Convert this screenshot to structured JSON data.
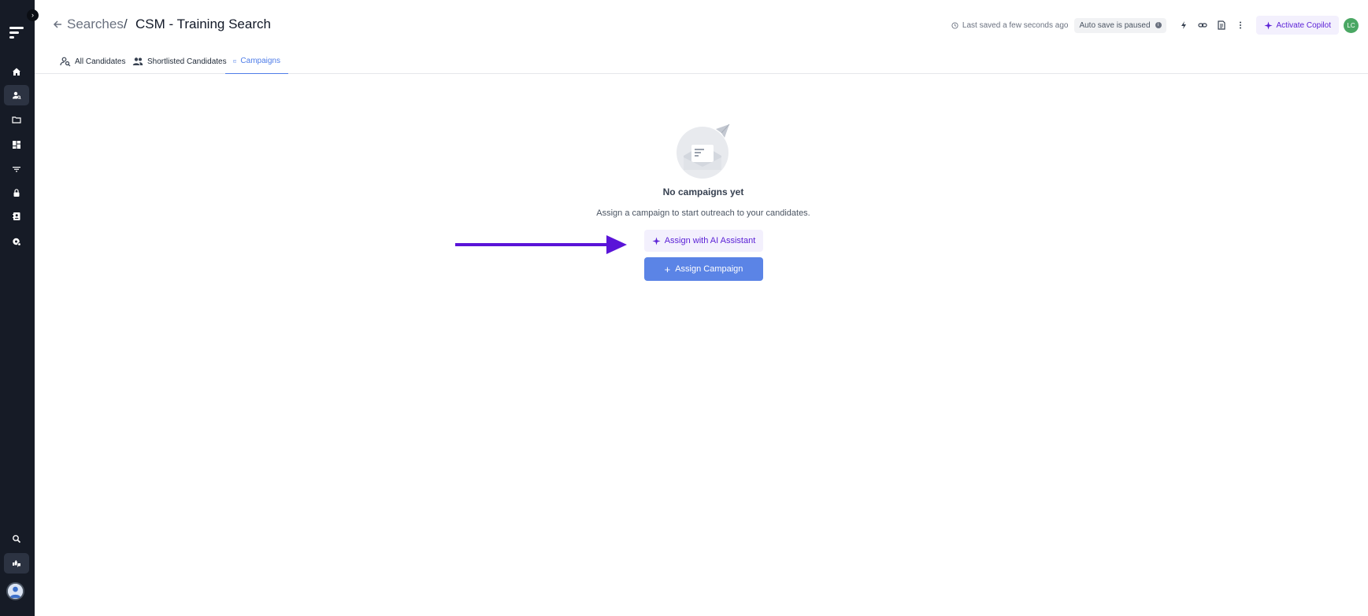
{
  "sidebar": {
    "toggle_glyph": "›",
    "items": [
      {
        "icon": "home-icon",
        "active": false
      },
      {
        "icon": "candidate-search-icon",
        "active": true
      },
      {
        "icon": "folder-icon",
        "active": false
      },
      {
        "icon": "dashboard-icon",
        "active": false
      },
      {
        "icon": "filter-icon",
        "active": false
      },
      {
        "icon": "lock-icon",
        "active": false
      },
      {
        "icon": "contacts-icon",
        "active": false
      },
      {
        "icon": "settings-icon",
        "active": false
      }
    ],
    "bottom": [
      {
        "icon": "search-icon"
      },
      {
        "icon": "feedback-icon"
      }
    ]
  },
  "header": {
    "breadcrumb_parent": "Searches",
    "breadcrumb_sep": "/",
    "title": "CSM - Training Search",
    "last_saved": "Last saved a few seconds ago",
    "autosave": "Auto save is paused",
    "copilot_label": "Activate Copilot",
    "user_initials": "LC"
  },
  "tabs": [
    {
      "label": "All Candidates",
      "icon": "person-search-icon"
    },
    {
      "label": "Shortlisted Candidates",
      "icon": "people-icon"
    },
    {
      "label": "Campaigns",
      "icon": "mail-icon",
      "active": true
    }
  ],
  "empty_state": {
    "title": "No campaigns yet",
    "description": "Assign a campaign to start outreach to your candidates.",
    "ai_button": "Assign with AI Assistant",
    "assign_button": "Assign Campaign",
    "assign_plus": "+"
  },
  "colors": {
    "sidebar_bg": "#161b26",
    "accent_blue": "#5b84e6",
    "accent_purple": "#5b21d6",
    "annotation_arrow": "#5a14d8"
  }
}
